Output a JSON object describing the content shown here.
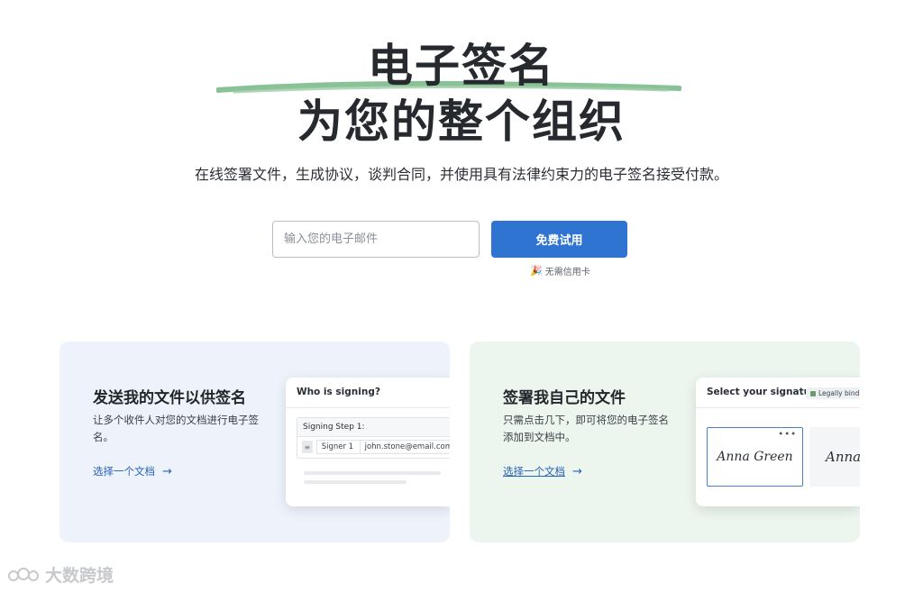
{
  "hero": {
    "title_line_1": "电子签名",
    "title_line_2": "为您的整个组织",
    "subtitle": "在线签署文件，生成协议，谈判合同，并使用具有法律约束力的电子签名接受付款。",
    "brush_color": "#7dbb8c"
  },
  "signup": {
    "email_placeholder": "输入您的电子邮件",
    "cta_label": "免费试用",
    "no_card_text": "无需信用卡",
    "no_card_icon": "party-popper-icon"
  },
  "cards": {
    "send": {
      "title": "发送我的文件以供签名",
      "description": "让多个收件人对您的文档进行电子签名。",
      "link_label": "选择一个文档",
      "panel_title": "Who is signing?",
      "step_label": "Signing Step 1:",
      "signer_label": "Signer 1",
      "signer_email": "john.stone@email.com",
      "background": "#eef3fb"
    },
    "self": {
      "title": "签署我自己的文件",
      "description": "只需点击几下，即可将您的电子签名添加到文档中。",
      "link_label": "选择一个文档",
      "panel_title": "Select your signature",
      "badge_label": "Legally binding",
      "signature_1": "Anna Green",
      "signature_2": "Anna G",
      "background": "#ecf6ef"
    }
  },
  "watermark": {
    "text": "大数跨境"
  },
  "colors": {
    "accent": "#2f74d0",
    "link": "#2a62b4"
  }
}
